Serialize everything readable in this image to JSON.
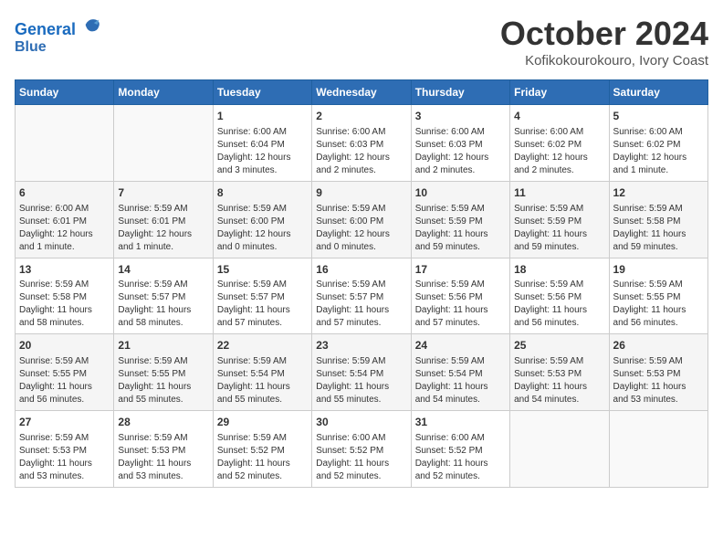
{
  "header": {
    "logo_line1": "General",
    "logo_line2": "Blue",
    "month_title": "October 2024",
    "subtitle": "Kofikokourokouro, Ivory Coast"
  },
  "weekdays": [
    "Sunday",
    "Monday",
    "Tuesday",
    "Wednesday",
    "Thursday",
    "Friday",
    "Saturday"
  ],
  "weeks": [
    [
      {
        "day": "",
        "info": ""
      },
      {
        "day": "",
        "info": ""
      },
      {
        "day": "1",
        "info": "Sunrise: 6:00 AM\nSunset: 6:04 PM\nDaylight: 12 hours\nand 3 minutes."
      },
      {
        "day": "2",
        "info": "Sunrise: 6:00 AM\nSunset: 6:03 PM\nDaylight: 12 hours\nand 2 minutes."
      },
      {
        "day": "3",
        "info": "Sunrise: 6:00 AM\nSunset: 6:03 PM\nDaylight: 12 hours\nand 2 minutes."
      },
      {
        "day": "4",
        "info": "Sunrise: 6:00 AM\nSunset: 6:02 PM\nDaylight: 12 hours\nand 2 minutes."
      },
      {
        "day": "5",
        "info": "Sunrise: 6:00 AM\nSunset: 6:02 PM\nDaylight: 12 hours\nand 1 minute."
      }
    ],
    [
      {
        "day": "6",
        "info": "Sunrise: 6:00 AM\nSunset: 6:01 PM\nDaylight: 12 hours\nand 1 minute."
      },
      {
        "day": "7",
        "info": "Sunrise: 5:59 AM\nSunset: 6:01 PM\nDaylight: 12 hours\nand 1 minute."
      },
      {
        "day": "8",
        "info": "Sunrise: 5:59 AM\nSunset: 6:00 PM\nDaylight: 12 hours\nand 0 minutes."
      },
      {
        "day": "9",
        "info": "Sunrise: 5:59 AM\nSunset: 6:00 PM\nDaylight: 12 hours\nand 0 minutes."
      },
      {
        "day": "10",
        "info": "Sunrise: 5:59 AM\nSunset: 5:59 PM\nDaylight: 11 hours\nand 59 minutes."
      },
      {
        "day": "11",
        "info": "Sunrise: 5:59 AM\nSunset: 5:59 PM\nDaylight: 11 hours\nand 59 minutes."
      },
      {
        "day": "12",
        "info": "Sunrise: 5:59 AM\nSunset: 5:58 PM\nDaylight: 11 hours\nand 59 minutes."
      }
    ],
    [
      {
        "day": "13",
        "info": "Sunrise: 5:59 AM\nSunset: 5:58 PM\nDaylight: 11 hours\nand 58 minutes."
      },
      {
        "day": "14",
        "info": "Sunrise: 5:59 AM\nSunset: 5:57 PM\nDaylight: 11 hours\nand 58 minutes."
      },
      {
        "day": "15",
        "info": "Sunrise: 5:59 AM\nSunset: 5:57 PM\nDaylight: 11 hours\nand 57 minutes."
      },
      {
        "day": "16",
        "info": "Sunrise: 5:59 AM\nSunset: 5:57 PM\nDaylight: 11 hours\nand 57 minutes."
      },
      {
        "day": "17",
        "info": "Sunrise: 5:59 AM\nSunset: 5:56 PM\nDaylight: 11 hours\nand 57 minutes."
      },
      {
        "day": "18",
        "info": "Sunrise: 5:59 AM\nSunset: 5:56 PM\nDaylight: 11 hours\nand 56 minutes."
      },
      {
        "day": "19",
        "info": "Sunrise: 5:59 AM\nSunset: 5:55 PM\nDaylight: 11 hours\nand 56 minutes."
      }
    ],
    [
      {
        "day": "20",
        "info": "Sunrise: 5:59 AM\nSunset: 5:55 PM\nDaylight: 11 hours\nand 56 minutes."
      },
      {
        "day": "21",
        "info": "Sunrise: 5:59 AM\nSunset: 5:55 PM\nDaylight: 11 hours\nand 55 minutes."
      },
      {
        "day": "22",
        "info": "Sunrise: 5:59 AM\nSunset: 5:54 PM\nDaylight: 11 hours\nand 55 minutes."
      },
      {
        "day": "23",
        "info": "Sunrise: 5:59 AM\nSunset: 5:54 PM\nDaylight: 11 hours\nand 55 minutes."
      },
      {
        "day": "24",
        "info": "Sunrise: 5:59 AM\nSunset: 5:54 PM\nDaylight: 11 hours\nand 54 minutes."
      },
      {
        "day": "25",
        "info": "Sunrise: 5:59 AM\nSunset: 5:53 PM\nDaylight: 11 hours\nand 54 minutes."
      },
      {
        "day": "26",
        "info": "Sunrise: 5:59 AM\nSunset: 5:53 PM\nDaylight: 11 hours\nand 53 minutes."
      }
    ],
    [
      {
        "day": "27",
        "info": "Sunrise: 5:59 AM\nSunset: 5:53 PM\nDaylight: 11 hours\nand 53 minutes."
      },
      {
        "day": "28",
        "info": "Sunrise: 5:59 AM\nSunset: 5:53 PM\nDaylight: 11 hours\nand 53 minutes."
      },
      {
        "day": "29",
        "info": "Sunrise: 5:59 AM\nSunset: 5:52 PM\nDaylight: 11 hours\nand 52 minutes."
      },
      {
        "day": "30",
        "info": "Sunrise: 6:00 AM\nSunset: 5:52 PM\nDaylight: 11 hours\nand 52 minutes."
      },
      {
        "day": "31",
        "info": "Sunrise: 6:00 AM\nSunset: 5:52 PM\nDaylight: 11 hours\nand 52 minutes."
      },
      {
        "day": "",
        "info": ""
      },
      {
        "day": "",
        "info": ""
      }
    ]
  ]
}
